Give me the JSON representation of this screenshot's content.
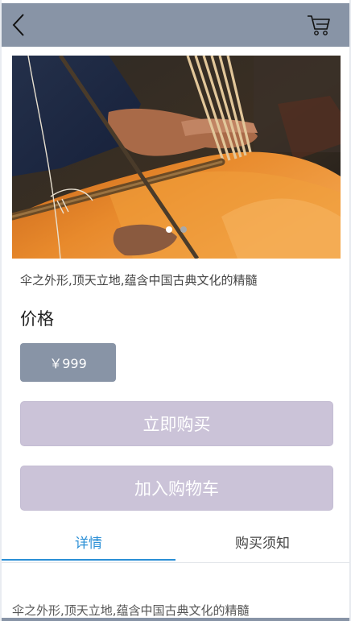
{
  "header": {
    "back_icon": "chevron-left-icon",
    "cart_icon": "shopping-cart-icon"
  },
  "banner": {
    "image_label": "craftsman-hands-making-umbrella-photo",
    "slide_count": 2,
    "active_slide": 1
  },
  "product": {
    "description": "伞之外形,顶天立地,蕴含中国古典文化的精髓",
    "price_title": "价格",
    "price": "￥999"
  },
  "actions": {
    "buy_now": "立即购买",
    "add_to_cart": "加入购物车"
  },
  "tabs": [
    {
      "label": "详情",
      "active": true
    },
    {
      "label": "购买须知",
      "active": false
    }
  ],
  "details": {
    "text": "伞之外形,顶天立地,蕴含中国古典文化的精髓"
  },
  "colors": {
    "header_bg": "#8894a6",
    "price_bg": "#8894a6",
    "button_bg": "#cbc3d8",
    "tab_active": "#2a8fd6",
    "tab_inactive": "#444444",
    "dot_active": "#ffffff",
    "dot_inactive": "#a9a9a9"
  }
}
